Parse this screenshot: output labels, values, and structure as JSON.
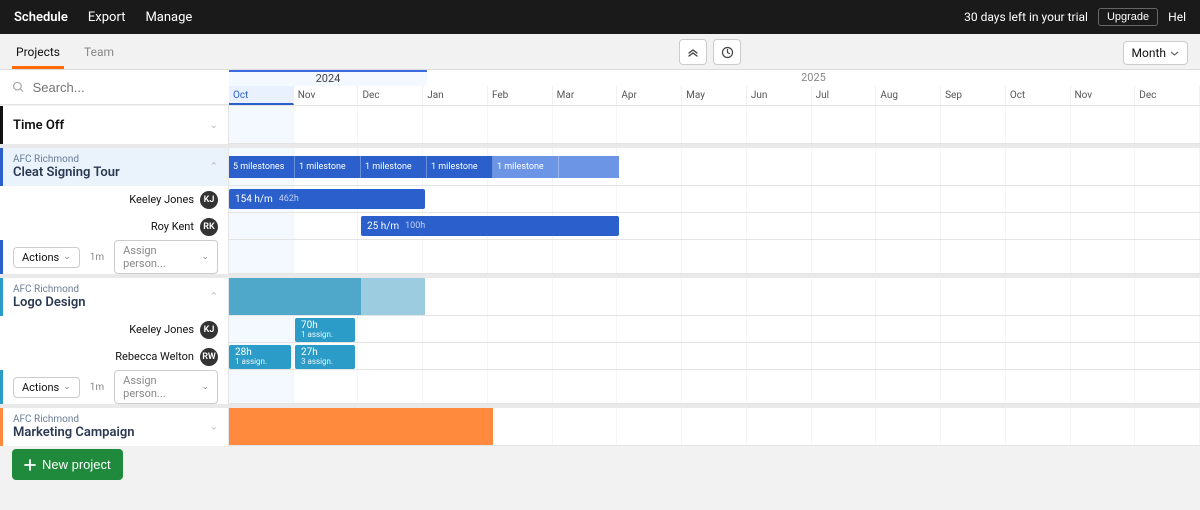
{
  "topbar": {
    "tabs": [
      "Schedule",
      "Export",
      "Manage"
    ],
    "trial_text": "30 days left in your trial",
    "upgrade": "Upgrade",
    "help": "Hel"
  },
  "subbar": {
    "tabs": [
      "Projects",
      "Team"
    ],
    "zoom_label": "Month"
  },
  "search": {
    "placeholder": "Search..."
  },
  "timeline": {
    "years": [
      "2024",
      "2025"
    ],
    "months": [
      "Oct",
      "Nov",
      "Dec",
      "Jan",
      "Feb",
      "Mar",
      "Apr",
      "May",
      "Jun",
      "Jul",
      "Aug",
      "Sep",
      "Oct",
      "Nov",
      "Dec"
    ],
    "current_month_index": 0,
    "year_split_after_index": 2
  },
  "sections": {
    "time_off": {
      "title": "Time Off"
    }
  },
  "projects": [
    {
      "client": "AFC Richmond",
      "name": "Cleat Signing Tour",
      "accent": "#2a5fcc",
      "milestones": [
        {
          "label": "5 milestones",
          "col": 0
        },
        {
          "label": "1 milestone",
          "col": 1
        },
        {
          "label": "1 milestone",
          "col": 2
        },
        {
          "label": "1 milestone",
          "col": 3
        },
        {
          "label": "1 milestone",
          "col": 4,
          "light": true
        },
        {
          "label": "",
          "col": 5,
          "light": true
        }
      ],
      "people": [
        {
          "name": "Keeley Jones",
          "initials": "KJ",
          "bar": {
            "label": "154 h/m",
            "extra": "462h",
            "start": 0,
            "span": 3,
            "color": "blue"
          }
        },
        {
          "name": "Roy Kent",
          "initials": "RK",
          "bar": {
            "label": "25 h/m",
            "extra": "100h",
            "start": 2,
            "span": 4,
            "color": "blue"
          }
        }
      ],
      "actions_count": "1m"
    },
    {
      "client": "AFC Richmond",
      "name": "Logo Design",
      "accent": "#2b9bc7",
      "overview": [
        {
          "start": 0,
          "span": 2,
          "class": "ov-teal1"
        },
        {
          "start": 2,
          "span": 1,
          "class": "ov-teal2"
        }
      ],
      "people": [
        {
          "name": "Keeley Jones",
          "initials": "KJ",
          "bar": {
            "label": "70h",
            "sub": "1 assign.",
            "start": 1,
            "span": 1,
            "color": "teal"
          }
        },
        {
          "name": "Rebecca Welton",
          "initials": "RW",
          "bars": [
            {
              "label": "28h",
              "sub": "1 assign.",
              "start": 0,
              "span": 1,
              "color": "teal"
            },
            {
              "label": "27h",
              "sub": "3 assign.",
              "start": 1,
              "span": 1,
              "color": "teal"
            }
          ]
        }
      ],
      "actions_count": "1m"
    },
    {
      "client": "AFC Richmond",
      "name": "Marketing Campaign",
      "accent": "#ff8a3d",
      "overview": [
        {
          "start": 0,
          "span": 4,
          "class": "ov-orange"
        }
      ]
    }
  ],
  "controls": {
    "actions_label": "Actions",
    "assign_placeholder": "Assign person...",
    "new_project": "New project"
  }
}
